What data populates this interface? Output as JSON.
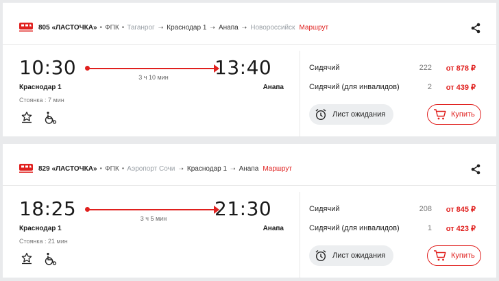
{
  "colors": {
    "accent": "#e0201e",
    "muted": "#9aa0a6",
    "bg": "#e9eaec"
  },
  "trains": [
    {
      "number": "805 «ЛАСТОЧКА»",
      "carrier": "ФПК",
      "stations": [
        "Таганрог",
        "Краснодар 1",
        "Анапа",
        "Новороссийск"
      ],
      "route_link": "Маршрут",
      "dep_time": "10:30",
      "arr_time": "13:40",
      "duration": "3 ч 10 мин",
      "from": "Краснодар 1",
      "to": "Анапа",
      "stop": "Стоянка : 7 мин",
      "seats": [
        {
          "name": "Сидячий",
          "count": "222",
          "price": "от 878 ₽"
        },
        {
          "name": "Сидячий (для инвалидов)",
          "count": "2",
          "price": "от 439 ₽"
        }
      ],
      "wait_label": "Лист ожидания",
      "buy_label": "Купить"
    },
    {
      "number": "829 «ЛАСТОЧКА»",
      "carrier": "ФПК",
      "stations": [
        "Аэропорт Сочи",
        "Краснодар 1",
        "Анапа"
      ],
      "route_link": "Маршрут",
      "dep_time": "18:25",
      "arr_time": "21:30",
      "duration": "3 ч 5 мин",
      "from": "Краснодар 1",
      "to": "Анапа",
      "stop": "Стоянка : 21 мин",
      "seats": [
        {
          "name": "Сидячий",
          "count": "208",
          "price": "от 845 ₽"
        },
        {
          "name": "Сидячий (для инвалидов)",
          "count": "1",
          "price": "от 423 ₽"
        }
      ],
      "wait_label": "Лист ожидания",
      "buy_label": "Купить"
    }
  ],
  "icons": [
    "train-icon",
    "share-icon",
    "star-badge-icon",
    "wheelchair-icon",
    "alarm-clock-icon",
    "cart-icon"
  ]
}
